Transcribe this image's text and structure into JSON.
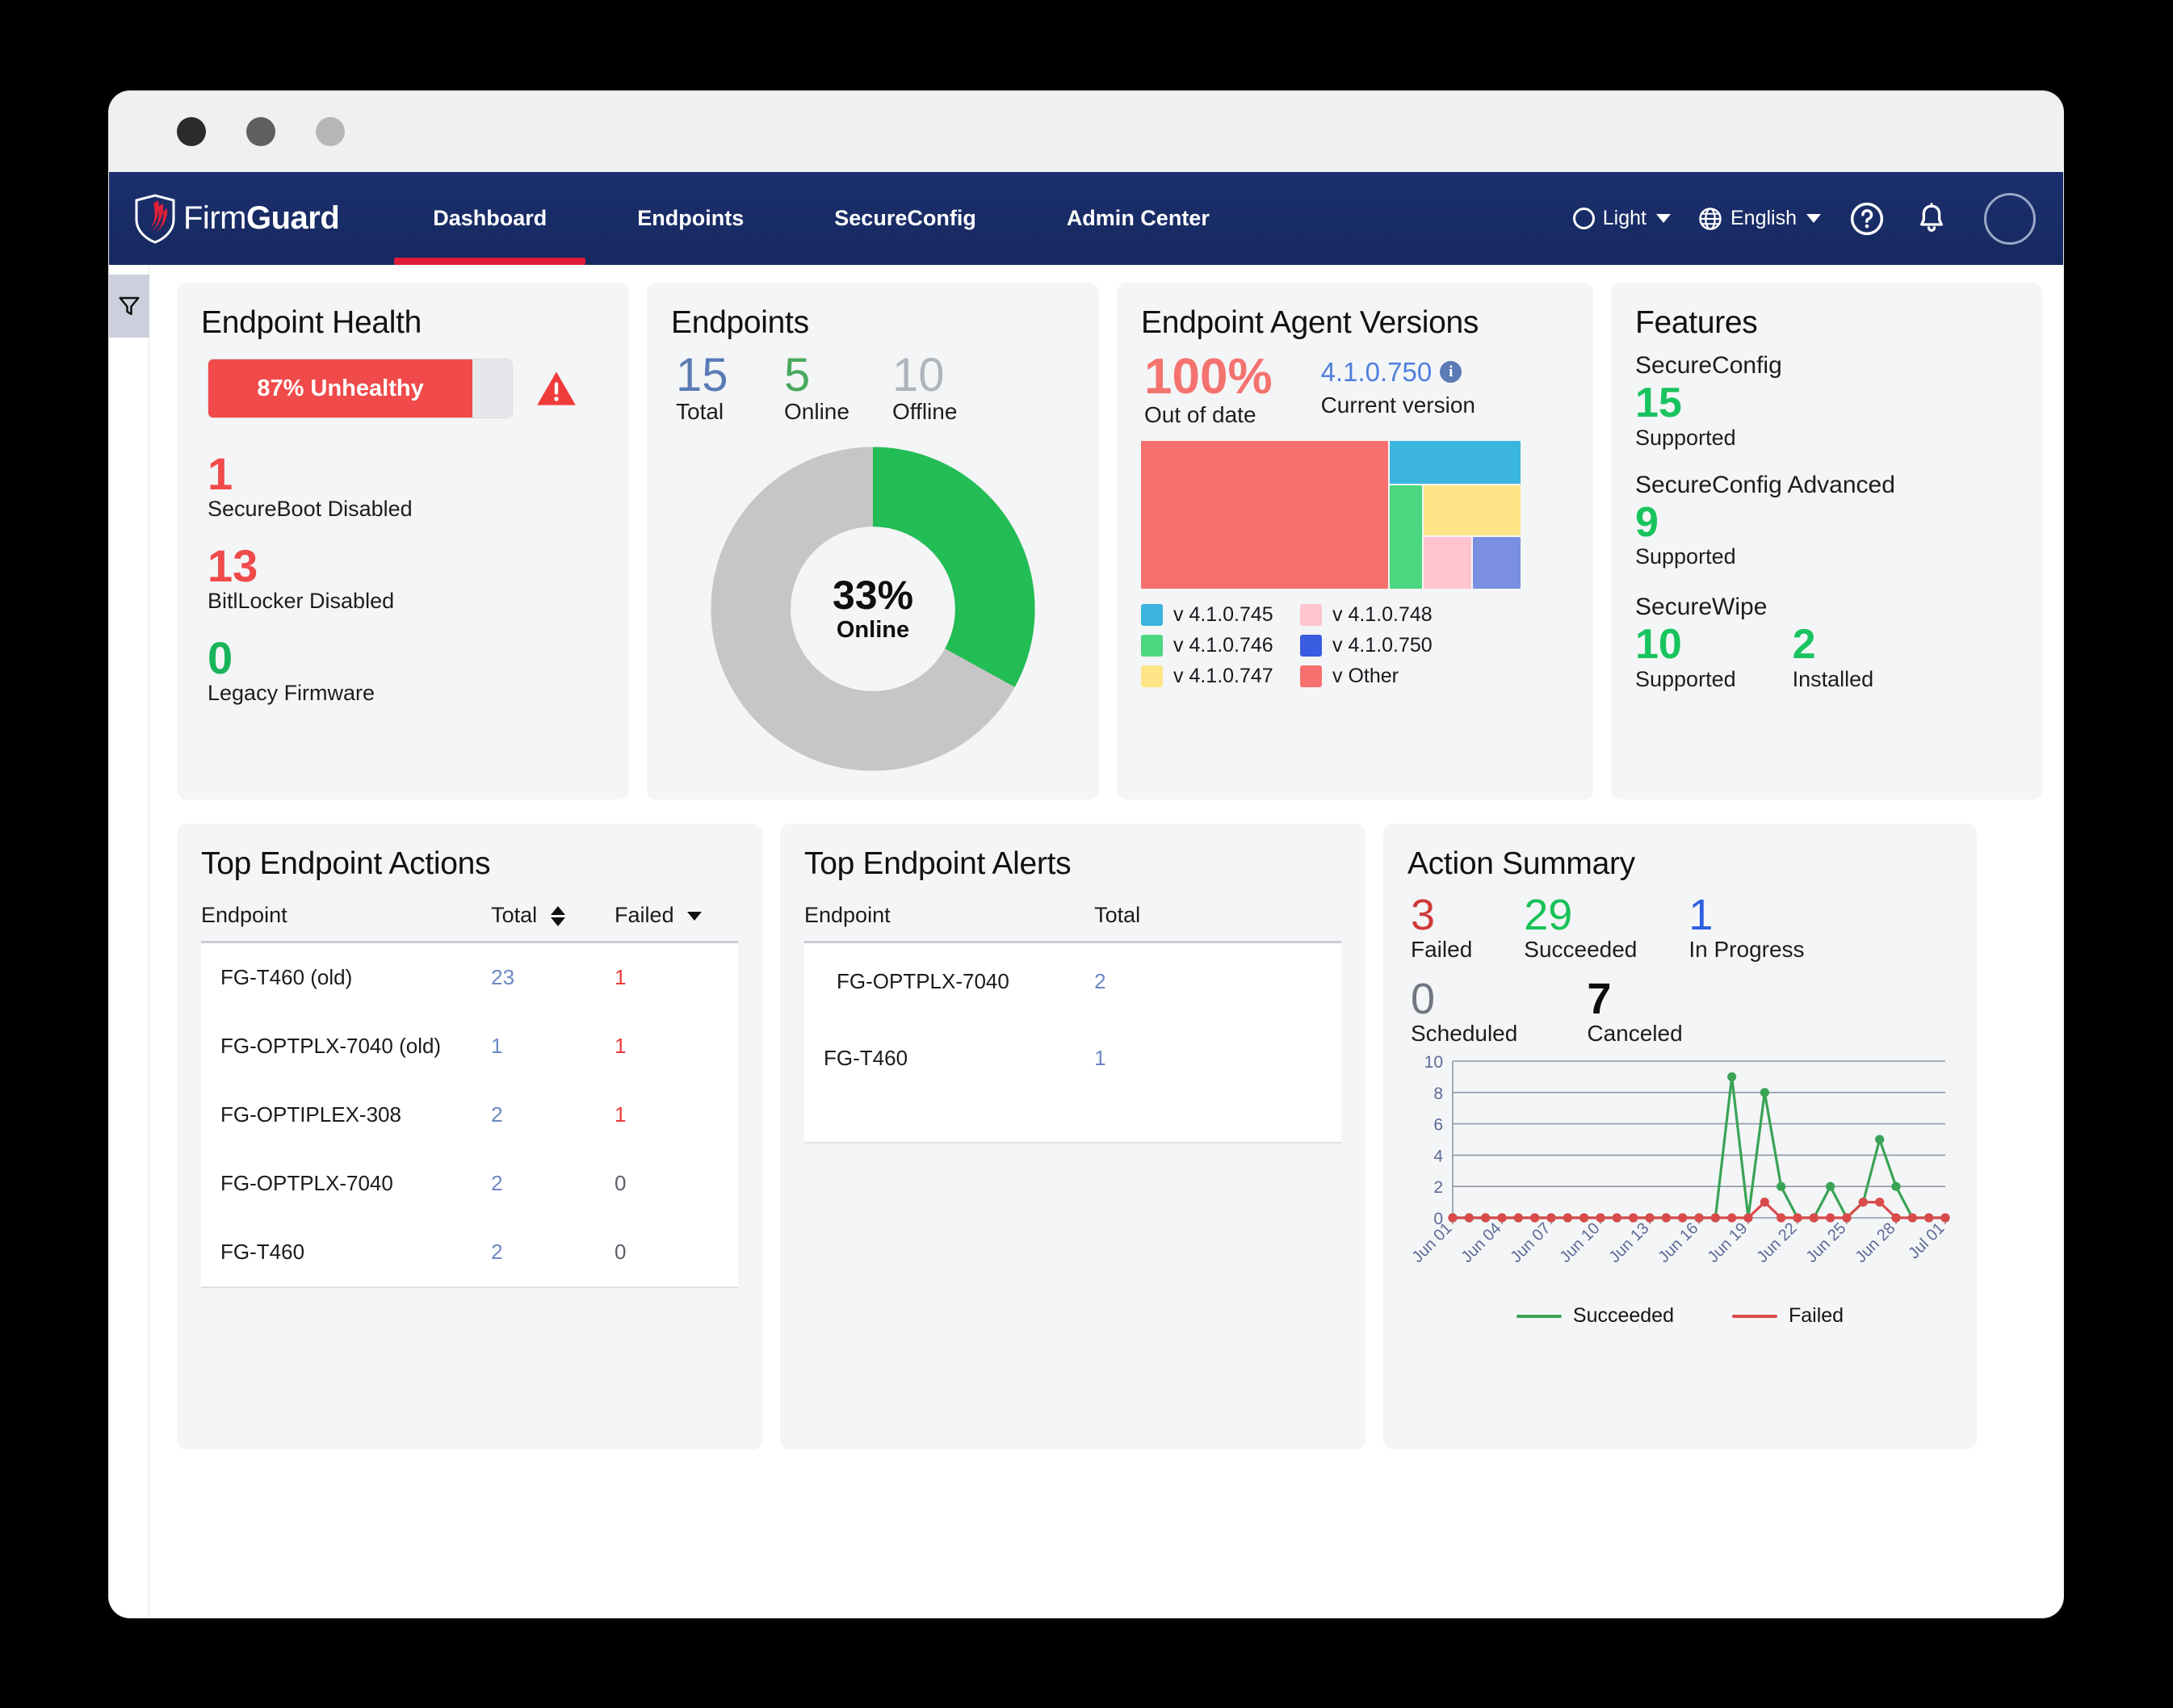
{
  "window": {
    "dots": [
      "close-dot",
      "minimize-dot",
      "maximize-dot"
    ]
  },
  "nav": {
    "brand_prefix": "Firm",
    "brand_suffix": "Guard",
    "tabs": [
      {
        "label": "Dashboard",
        "active": true
      },
      {
        "label": "Endpoints",
        "active": false
      },
      {
        "label": "SecureConfig",
        "active": false
      },
      {
        "label": "Admin Center",
        "active": false
      }
    ],
    "theme_label": "Light",
    "language_label": "English",
    "help_icon": "help-circle-icon",
    "bell_icon": "bell-icon",
    "avatar": "user-avatar",
    "active_underline_color": "#e01a38"
  },
  "sidebar": {
    "filter_icon": "filter-funnel-icon"
  },
  "endpoint_health": {
    "title": "Endpoint Health",
    "bar_label": "87% Unhealthy",
    "bar_percent": 87,
    "warning_icon": "warning-triangle-icon",
    "stats": [
      {
        "value": "1",
        "label": "SecureBoot Disabled",
        "color": "red"
      },
      {
        "value": "13",
        "label": "BitlLocker Disabled",
        "color": "red"
      },
      {
        "value": "0",
        "label": "Legacy Firmware",
        "color": "green"
      }
    ]
  },
  "endpoints": {
    "title": "Endpoints",
    "counts": [
      {
        "value": "15",
        "label": "Total",
        "cls": "total"
      },
      {
        "value": "5",
        "label": "Online",
        "cls": "online"
      },
      {
        "value": "10",
        "label": "Offline",
        "cls": "offline"
      }
    ],
    "donut_center_pct": "33%",
    "donut_center_label": "Online",
    "chart_data": {
      "type": "pie",
      "title": "Endpoints Online",
      "categories": [
        "Online",
        "Offline"
      ],
      "values": [
        33,
        67
      ],
      "colors": [
        "#22bd54",
        "#c6c6c6"
      ],
      "legend": "none"
    }
  },
  "agent_versions": {
    "title": "Endpoint Agent Versions",
    "out_of_date_pct": "100%",
    "out_of_date_label": "Out of date",
    "current_version": "4.1.0.750",
    "current_version_label": "Current version",
    "info_icon": "info-icon",
    "legend": [
      {
        "label": "v 4.1.0.745",
        "color": "#3bb4de"
      },
      {
        "label": "v 4.1.0.746",
        "color": "#4bd67f"
      },
      {
        "label": "v 4.1.0.747",
        "color": "#ffe588"
      },
      {
        "label": "v 4.1.0.748",
        "color": "#ffc4cd"
      },
      {
        "label": "v 4.1.0.750",
        "color": "#3a5ce0"
      },
      {
        "label": "v Other",
        "color": "#f7706e"
      }
    ],
    "chart_data": {
      "type": "treemap",
      "title": "Endpoint Agent Versions",
      "categories": [
        "v Other",
        "v 4.1.0.745",
        "v 4.1.0.746",
        "v 4.1.0.747",
        "v 4.1.0.748",
        "v 4.1.0.750"
      ],
      "values": [
        60,
        13,
        7,
        12,
        4,
        4
      ],
      "colors": [
        "#f7706e",
        "#3bb4de",
        "#4bd67f",
        "#ffe588",
        "#ffc4cd",
        "#3a5ce0"
      ]
    }
  },
  "features": {
    "title": "Features",
    "items": [
      {
        "name": "SecureConfig",
        "values": [
          {
            "num": "15",
            "sub": "Supported"
          }
        ]
      },
      {
        "name": "SecureConfig Advanced",
        "values": [
          {
            "num": "9",
            "sub": "Supported"
          }
        ]
      },
      {
        "name": "SecureWipe",
        "values": [
          {
            "num": "10",
            "sub": "Supported"
          },
          {
            "num": "2",
            "sub": "Installed"
          }
        ]
      }
    ]
  },
  "top_actions": {
    "title": "Top Endpoint Actions",
    "columns": [
      "Endpoint",
      "Total",
      "Failed"
    ],
    "sort_total_icon": "sort-both-icon",
    "sort_failed_icon": "sort-desc-icon",
    "rows": [
      {
        "endpoint": "FG-T460 (old)",
        "total": "23",
        "failed": "1"
      },
      {
        "endpoint": "FG-OPTPLX-7040 (old)",
        "total": "1",
        "failed": "1"
      },
      {
        "endpoint": "FG-OPTIPLEX-308",
        "total": "2",
        "failed": "1"
      },
      {
        "endpoint": "FG-OPTPLX-7040",
        "total": "2",
        "failed": "0"
      },
      {
        "endpoint": "FG-T460",
        "total": "2",
        "failed": "0"
      }
    ]
  },
  "top_alerts": {
    "title": "Top Endpoint Alerts",
    "columns": [
      "Endpoint",
      "Total"
    ],
    "rows": [
      {
        "endpoint": "FG-OPTPLX-7040",
        "total": "2"
      },
      {
        "endpoint": "FG-T460",
        "total": "1"
      }
    ]
  },
  "action_summary": {
    "title": "Action Summary",
    "row1": [
      {
        "num": "3",
        "label": "Failed",
        "cls": "failed"
      },
      {
        "num": "29",
        "label": "Succeeded",
        "cls": "succ"
      },
      {
        "num": "1",
        "label": "In Progress",
        "cls": "prog"
      }
    ],
    "row2": [
      {
        "num": "0",
        "label": "Scheduled",
        "cls": "sched"
      },
      {
        "num": "7",
        "label": "Canceled",
        "cls": "canc"
      }
    ],
    "chart_data": {
      "type": "line",
      "title": "",
      "xlabel": "",
      "ylabel": "",
      "ylim": [
        0,
        10
      ],
      "yticks": [
        0,
        2,
        4,
        6,
        8,
        10
      ],
      "grid": true,
      "legend": "bottom-center",
      "x": [
        "Jun 01",
        "Jun 02",
        "Jun 03",
        "Jun 04",
        "Jun 05",
        "Jun 06",
        "Jun 07",
        "Jun 08",
        "Jun 09",
        "Jun 10",
        "Jun 11",
        "Jun 12",
        "Jun 13",
        "Jun 14",
        "Jun 15",
        "Jun 16",
        "Jun 17",
        "Jun 18",
        "Jun 19",
        "Jun 20",
        "Jun 21",
        "Jun 22",
        "Jun 23",
        "Jun 24",
        "Jun 25",
        "Jun 26",
        "Jun 27",
        "Jun 28",
        "Jun 29",
        "Jun 30",
        "Jul 01"
      ],
      "xtick_labels": [
        "Jun 01",
        "Jun 04",
        "Jun 07",
        "Jun 10",
        "Jun 13",
        "Jun 16",
        "Jun 19",
        "Jun 22",
        "Jun 25",
        "Jun 28",
        "Jul 01"
      ],
      "series": [
        {
          "name": "Succeeded",
          "color": "#3aa355",
          "values": [
            0,
            0,
            0,
            0,
            0,
            0,
            0,
            0,
            0,
            0,
            0,
            0,
            0,
            0,
            0,
            0,
            0,
            9,
            0,
            8,
            2,
            0,
            0,
            2,
            0,
            1,
            5,
            2,
            0,
            0,
            0
          ]
        },
        {
          "name": "Failed",
          "color": "#d94a4a",
          "values": [
            0,
            0,
            0,
            0,
            0,
            0,
            0,
            0,
            0,
            0,
            0,
            0,
            0,
            0,
            0,
            0,
            0,
            0,
            0,
            1,
            0,
            0,
            0,
            0,
            0,
            1,
            1,
            0,
            0,
            0,
            0
          ]
        }
      ]
    }
  }
}
